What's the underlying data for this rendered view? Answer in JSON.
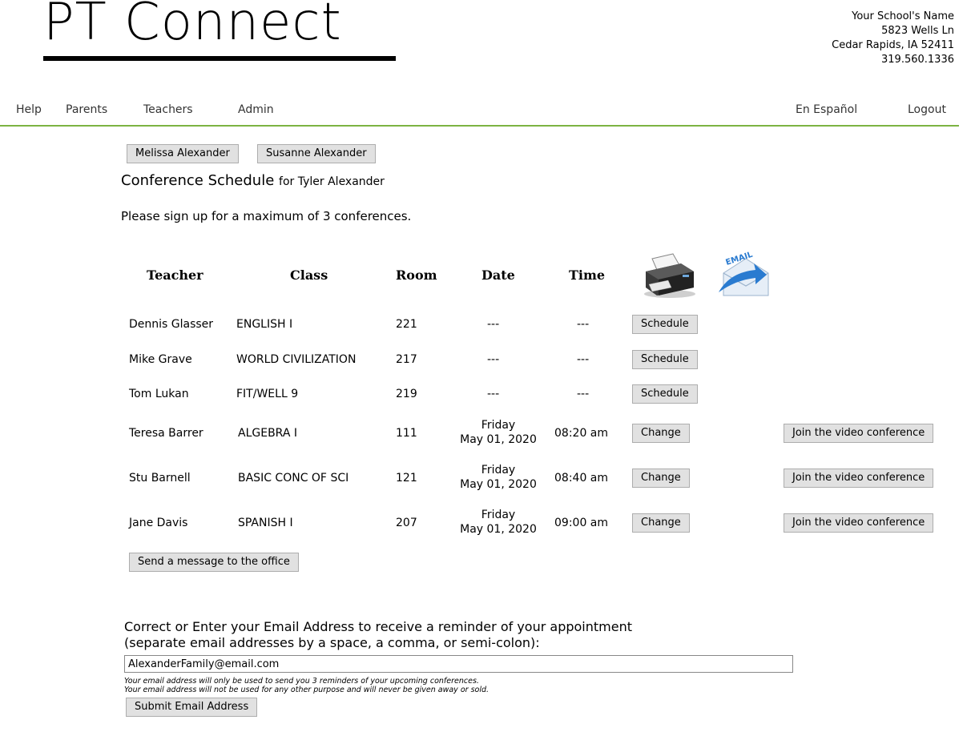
{
  "brand": {
    "logo_text": "PT Connect"
  },
  "school": {
    "name": "Your School's Name",
    "address1": "5823 Wells Ln",
    "address2": "Cedar Rapids, IA 52411",
    "phone": "319.560.1336"
  },
  "nav": {
    "help": "Help",
    "parents": "Parents",
    "teachers": "Teachers",
    "admin": "Admin",
    "spanish": "En Español",
    "logout": "Logout"
  },
  "parents": [
    "Melissa Alexander",
    "Susanne Alexander"
  ],
  "schedule": {
    "title": "Conference Schedule",
    "for_label": "for Tyler Alexander",
    "instructions": "Please sign up for a maximum of 3 conferences.",
    "headers": {
      "teacher": "Teacher",
      "class": "Class",
      "room": "Room",
      "date": "Date",
      "time": "Time"
    },
    "icons": {
      "print": "printer-icon",
      "email": "email-icon",
      "email_badge": "EMAIL"
    },
    "rows": [
      {
        "teacher": "Dennis Glasser",
        "class": "ENGLISH I",
        "room": "221",
        "day": "---",
        "date": "",
        "time": "---",
        "action": "Schedule",
        "video": ""
      },
      {
        "teacher": "Mike Grave",
        "class": "WORLD CIVILIZATION",
        "room": "217",
        "day": "---",
        "date": "",
        "time": "---",
        "action": "Schedule",
        "video": ""
      },
      {
        "teacher": "Tom Lukan",
        "class": "FIT/WELL 9",
        "room": "219",
        "day": "---",
        "date": "",
        "time": "---",
        "action": "Schedule",
        "video": ""
      },
      {
        "teacher": "Teresa Barrer",
        "class": "ALGEBRA I",
        "room": "111",
        "day": "Friday",
        "date": "May 01, 2020",
        "time": "08:20 am",
        "action": "Change",
        "video": "Join the video conference"
      },
      {
        "teacher": "Stu Barnell",
        "class": "BASIC CONC OF SCI",
        "room": "121",
        "day": "Friday",
        "date": "May 01, 2020",
        "time": "08:40 am",
        "action": "Change",
        "video": "Join the video conference"
      },
      {
        "teacher": "Jane Davis",
        "class": "SPANISH I",
        "room": "207",
        "day": "Friday",
        "date": "May 01, 2020",
        "time": "09:00 am",
        "action": "Change",
        "video": "Join the video conference"
      }
    ],
    "message_button": "Send a message to the office"
  },
  "email": {
    "label_line1": "Correct or Enter your Email Address to receive a reminder of your appointment",
    "label_line2": "(separate email addresses by a space, a comma, or semi-colon):",
    "value": "AlexanderFamily@email.com",
    "note1": "Your email address will only be used to send you 3 reminders of your upcoming conferences.",
    "note2": "Your email address will not be used for any other purpose and will never be given away or sold.",
    "submit": "Submit Email Address"
  },
  "colors": {
    "accent_line": "#7cb342",
    "button_bg": "#e1e1e1",
    "button_border": "#adadad"
  }
}
